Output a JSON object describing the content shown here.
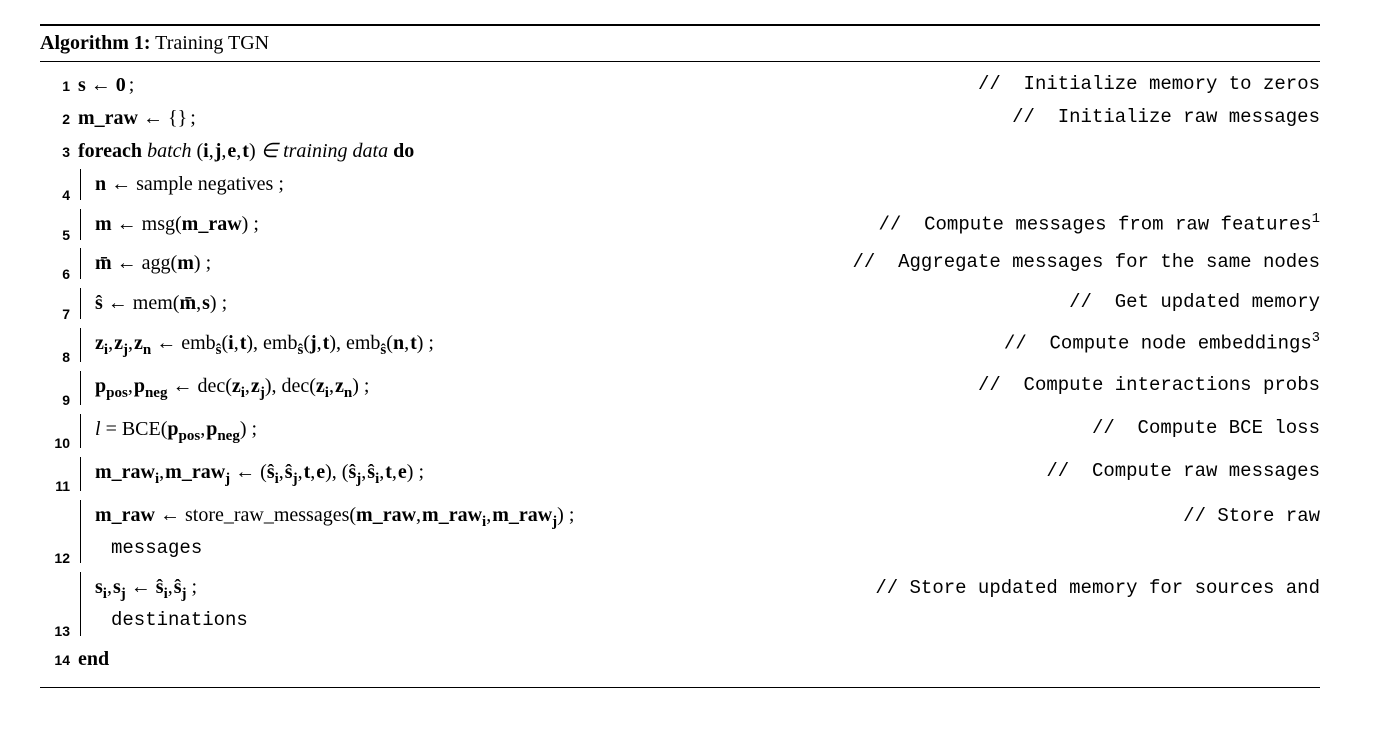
{
  "title_prefix": "Algorithm 1:",
  "title_text": " Training TGN",
  "lines": {
    "l1": {
      "no": "1",
      "code": "s ← 0",
      "comment": "//  Initialize memory to zeros"
    },
    "l2": {
      "no": "2",
      "code": "m_raw ← {}",
      "comment": "//  Initialize raw messages"
    },
    "l3": {
      "no": "3",
      "kw1": "foreach",
      "mid": " batch ",
      "tuple": "(i, j, e, t)",
      "in": " ∈ ",
      "data": "training data",
      "kw2": " do"
    },
    "l4": {
      "no": "4",
      "code": "n ← sample negatives",
      "sc": " ;"
    },
    "l5": {
      "no": "5",
      "code": "m ← msg(m_raw)",
      "sc": " ;",
      "comment": "//  Compute messages from raw features",
      "supnote": "1"
    },
    "l6": {
      "no": "6",
      "code": "m̄ ← agg(m)",
      "sc": " ;",
      "comment": "//  Aggregate messages for the same nodes"
    },
    "l7": {
      "no": "7",
      "code": "ŝ ← mem(m̄, s)",
      "sc": " ;",
      "comment": "//  Get updated memory"
    },
    "l8": {
      "no": "8",
      "code": "zᵢ, zⱼ, zₙ ← embŝ(i, t), embŝ(j, t), embŝ(n, t)",
      "sc": " ;",
      "comment": "//  Compute node embeddings",
      "supnote": "3"
    },
    "l9": {
      "no": "9",
      "code": "pₚₒₛ, pₙₑ𝓰 ← dec(zᵢ, zⱼ), dec(zᵢ, zₙ)",
      "sc": " ;",
      "comment": "//  Compute interactions probs"
    },
    "l10": {
      "no": "10",
      "code": "l = BCE(pₚₒₛ, pₙₑ𝓰)",
      "sc": " ;",
      "comment": "//  Compute BCE loss"
    },
    "l11": {
      "no": "11",
      "code": "m_rawᵢ, m_rawⱼ ← (ŝᵢ, ŝⱼ, t, e), (ŝⱼ, ŝᵢ, t, e)",
      "sc": " ;",
      "comment": "//  Compute raw messages"
    },
    "l12": {
      "no": "12",
      "code": "m_raw ← store_raw_messages(m_raw, m_rawᵢ, m_rawⱼ)",
      "sc": " ;",
      "comment": "//   Store raw",
      "comment_cont": "messages"
    },
    "l13": {
      "no": "13",
      "code": "sᵢ, sⱼ ← ŝᵢ, ŝⱼ",
      "sc": " ;",
      "comment": "//  Store updated memory for sources and",
      "comment_cont": "destinations"
    },
    "l14": {
      "no": "14",
      "kw": "end"
    }
  }
}
